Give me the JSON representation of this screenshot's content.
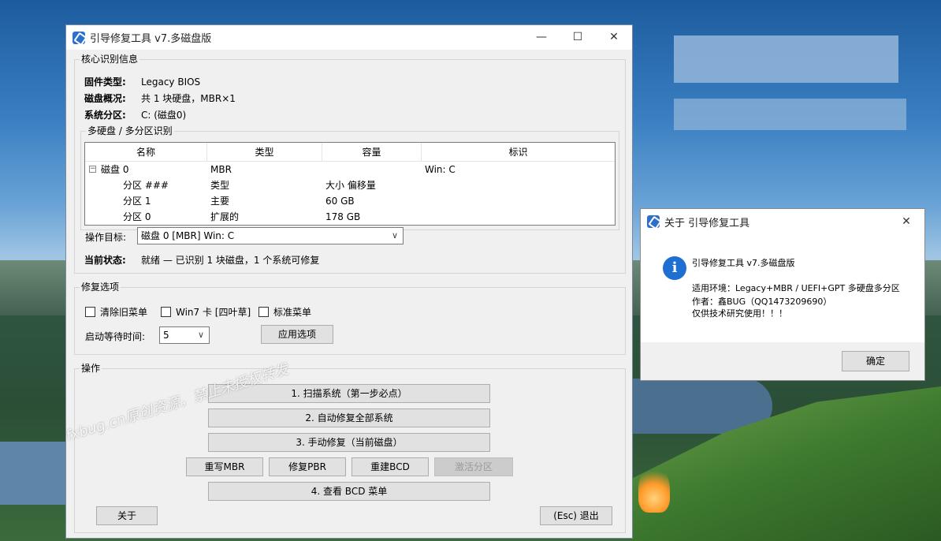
{
  "main": {
    "title": "引导修复工具 v7.多磁盘版",
    "minimize": "—",
    "maximize": "☐",
    "close": "✕",
    "core_group": "核心识别信息",
    "firmware_label": "固件类型:",
    "firmware_value": "Legacy BIOS",
    "disk_label": "磁盘概况:",
    "disk_value": "共 1 块硬盘，MBR×1",
    "sys_label": "系统分区:",
    "sys_value": "C: (磁盘0)",
    "multi_group": "多硬盘 / 多分区识别",
    "columns": [
      "名称",
      "类型",
      "容量",
      "标识"
    ],
    "rows": [
      {
        "name": "磁盘 0",
        "type": "MBR",
        "size": "",
        "tag": "Win: C",
        "expander": "−"
      },
      {
        "name": "分区 ###",
        "type": "类型",
        "size": "大小 偏移量",
        "tag": ""
      },
      {
        "name": "分区 1",
        "type": "主要",
        "size": "60 GB",
        "tag": ""
      },
      {
        "name": "分区 0",
        "type": "扩展的",
        "size": "178 GB",
        "tag": ""
      }
    ],
    "target_label": "操作目标:",
    "target_value": "磁盘 0  [MBR]    Win: C",
    "status_label": "当前状态:",
    "status_value": "就绪 — 已识别 1 块磁盘，1 个系统可修复",
    "repair_group": "修复选项",
    "chk_clear": "清除旧菜单",
    "chk_win7": "Win7 卡 [四叶草]",
    "chk_std": "标准菜单",
    "wait_label": "启动等待时间:",
    "wait_value": "5",
    "apply_btn": "应用选项",
    "ops_group": "操作",
    "btn_scan": "1. 扫描系统（第一步必点）",
    "btn_auto": "2. 自动修复全部系统",
    "btn_manual": "3. 手动修复（当前磁盘）",
    "btn_mbr": "重写MBR",
    "btn_pbr": "修复PBR",
    "btn_bcd": "重建BCD",
    "btn_active": "激活分区",
    "btn_view": "4. 查看 BCD 菜单",
    "btn_about": "关于",
    "btn_exit": "(Esc) 退出",
    "watermark": "fxbug.cn原创资源，禁止未授权转发"
  },
  "about": {
    "title": "关于 引导修复工具",
    "close": "✕",
    "icon": "i",
    "line1": "引导修复工具 v7.多磁盘版",
    "line2": "适用环境：Legacy+MBR / UEFI+GPT 多硬盘多分区",
    "line3": "作者：鑫BUG（QQ1473209690）",
    "line4": "仅供技术研究使用！！！",
    "ok": "确定"
  }
}
